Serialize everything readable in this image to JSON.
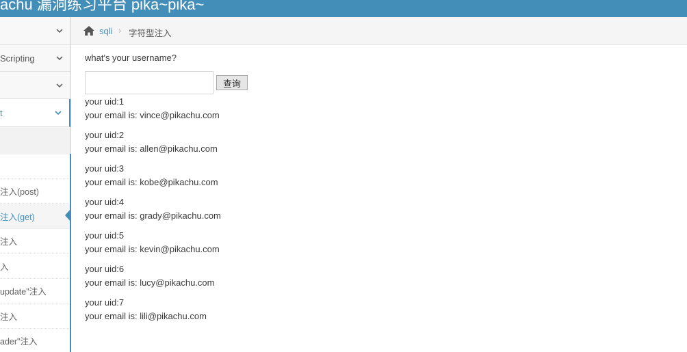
{
  "header": {
    "brand": "achu 漏洞练习平台 pika~pika~"
  },
  "sidebar": {
    "items": [
      {
        "label": ""
      },
      {
        "label": "Scripting"
      },
      {
        "label": ""
      },
      {
        "label": "t"
      }
    ],
    "sub_items": [
      {
        "label": ""
      },
      {
        "label": "注入(post)"
      },
      {
        "label": "注入(get)"
      },
      {
        "label": "注入"
      },
      {
        "label": "入"
      },
      {
        "label": "update\"注入"
      },
      {
        "label": "注入"
      },
      {
        "label": "ader\"注入"
      }
    ]
  },
  "breadcrumb": {
    "link": "sqli",
    "separator": "›",
    "current": "字符型注入"
  },
  "form": {
    "question": "what's your username?",
    "input_value": "",
    "button_label": "查询"
  },
  "results": [
    {
      "uid": "your uid:1",
      "email": "your email is: vince@pikachu.com"
    },
    {
      "uid": "your uid:2",
      "email": "your email is: allen@pikachu.com"
    },
    {
      "uid": "your uid:3",
      "email": "your email is: kobe@pikachu.com"
    },
    {
      "uid": "your uid:4",
      "email": "your email is: grady@pikachu.com"
    },
    {
      "uid": "your uid:5",
      "email": "your email is: kevin@pikachu.com"
    },
    {
      "uid": "your uid:6",
      "email": "your email is: lucy@pikachu.com"
    },
    {
      "uid": "your uid:7",
      "email": "your email is: lili@pikachu.com"
    }
  ],
  "colors": {
    "header_bg": "#438eb9",
    "link": "#4c8fbd",
    "accent": "#438eb9"
  },
  "icons": {
    "home": "home-icon",
    "chevron": "chevron-down-icon"
  }
}
